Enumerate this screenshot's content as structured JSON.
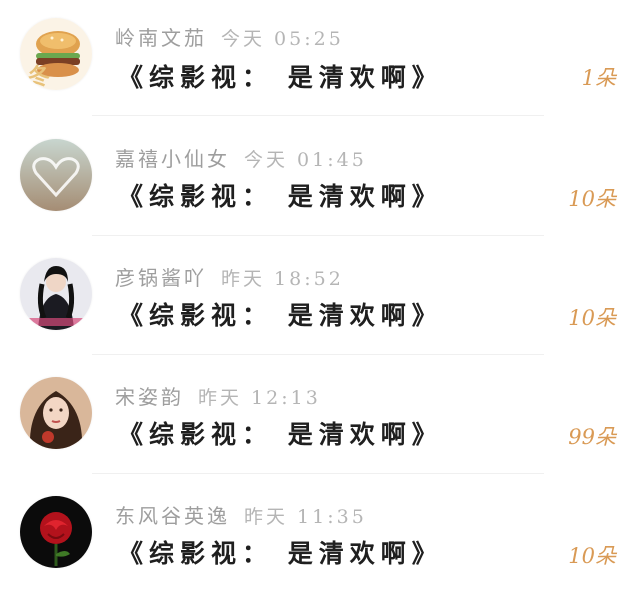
{
  "rows": [
    {
      "name": "岭南文茄",
      "time": "今天 05:25",
      "message": "《综影视： 是清欢啊》",
      "count": "1朵"
    },
    {
      "name": "嘉禧小仙女",
      "time": "今天 01:45",
      "message": "《综影视： 是清欢啊》",
      "count": "10朵"
    },
    {
      "name": "彦锅酱吖",
      "time": "昨天 18:52",
      "message": "《综影视： 是清欢啊》",
      "count": "10朵"
    },
    {
      "name": "宋姿韵",
      "time": "昨天 12:13",
      "message": "《综影视： 是清欢啊》",
      "count": "99朵"
    },
    {
      "name": "东风谷英逸",
      "time": "昨天 11:35",
      "message": "《综影视： 是清欢啊》",
      "count": "10朵"
    }
  ],
  "colors": {
    "count": "#d99a55",
    "name": "#9e9e9e",
    "message": "#1f1f1f"
  }
}
